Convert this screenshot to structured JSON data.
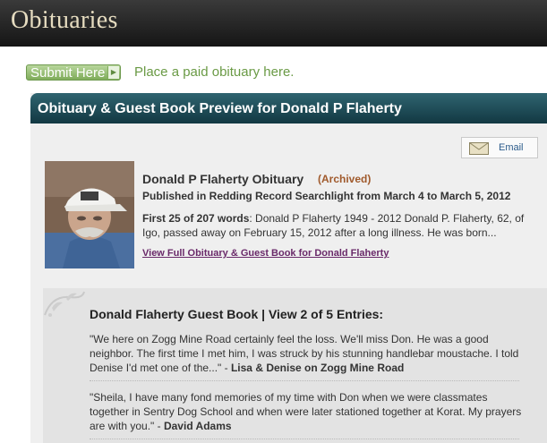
{
  "header": {
    "title": "Obituaries"
  },
  "submit": {
    "button_label": "Submit Here",
    "text": "Place a paid obituary here."
  },
  "preview": {
    "heading": "Obituary & Guest Book Preview for Donald P Flaherty",
    "email_label": "Email",
    "obit_title": "Donald P Flaherty Obituary",
    "status": "(Archived)",
    "published": "Published in Redding Record Searchlight from March 4 to March 5, 2012",
    "excerpt_prefix": "First 25 of 207 words",
    "excerpt_text": ": Donald P Flaherty 1949 - 2012 Donald P. Flaherty, 62, of Igo, passed away on February 15, 2012 after a long illness. He was born...",
    "view_link": "View Full Obituary & Guest Book for Donald Flaherty"
  },
  "guestbook": {
    "title": "Donald Flaherty Guest Book | View 2 of 5 Entries:",
    "entries": [
      {
        "text": "\"We here on Zogg Mine Road certainly feel the loss. We'll miss Don. He was a good neighbor. The first time I met him, I was struck by his stunning handlebar moustache. I told Denise I'd met one of the...\" - ",
        "author": "Lisa & Denise on Zogg Mine Road"
      },
      {
        "text": "\"Sheila, I have many fond memories of my time with Don when we were classmates together in Sentry Dog School and when were later stationed together at Korat. My prayers are with you.\" - ",
        "author": "David Adams"
      }
    ]
  }
}
